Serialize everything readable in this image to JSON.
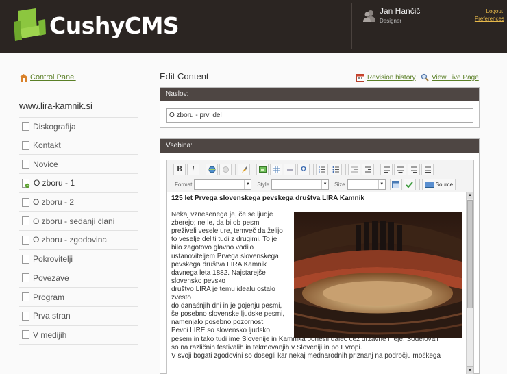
{
  "header": {
    "logo_text": "CushyCMS",
    "user_name": "Jan Hančič",
    "user_role": "Designer",
    "logout": "Logout",
    "preferences": "Preferences"
  },
  "sidebar": {
    "control_panel": "Control Panel",
    "site_name": "www.lira-kamnik.si",
    "pages": [
      {
        "label": "Diskografija"
      },
      {
        "label": "Kontakt"
      },
      {
        "label": "Novice"
      },
      {
        "label": "O zboru - 1"
      },
      {
        "label": "O zboru - 2"
      },
      {
        "label": "O zboru - sedanji člani"
      },
      {
        "label": "O zboru - zgodovina"
      },
      {
        "label": "Pokrovitelji"
      },
      {
        "label": "Povezave"
      },
      {
        "label": "Program"
      },
      {
        "label": "Prva stran"
      },
      {
        "label": "V medijih"
      }
    ]
  },
  "main": {
    "title": "Edit Content",
    "revision_history": "Revision history",
    "view_live_page": "View Live Page",
    "naslov_label": "Naslov:",
    "naslov_value": "O zboru - prvi del",
    "vsebina_label": "Vsebina:"
  },
  "toolbar": {
    "bold": "B",
    "italic": "I",
    "special_char": "Ω",
    "format_label": "Format",
    "style_label": "Style",
    "size_label": "Size",
    "source_label": "Source"
  },
  "document": {
    "heading": "125 let Prvega slovenskega pevskega društva LIRA Kamnik",
    "lines": [
      "Nekaj vznesenega je, če se ljudje",
      "zberejo; ne le, da bi ob pesmi",
      "preživeli vesele ure, temveč da želijo",
      "to veselje deliti tudi z drugimi. To je",
      "bilo zagotovo glavno vodilo",
      "ustanoviteljem Prvega slovenskega",
      "pevskega društva LIRA Kamnik",
      "davnega leta 1882. Najstarejše",
      "slovensko pevsko",
      "društvo LIRA je temu idealu ostalo",
      "zvesto",
      "do današnjih dni in je gojenju pesmi,",
      "še posebno slovenske ljudske pesmi,",
      "namenjalo posebno pozornost.",
      "Pevci LIRE so slovensko ljudsko",
      "pesem in tako tudi ime Slovenije in Kamnika ponesli daleč čez državne meje. Sodelovali",
      "so na različnih festivalih in tekmovanjih v Sloveniji in po Evropi.",
      "V svoji bogati zgodovini so dosegli kar nekaj mednarodnih priznanj na področju moškega"
    ]
  },
  "colors": {
    "header_bg": "#2b2522",
    "panel_header_bg": "#4e4643",
    "link_green": "#5a7f26",
    "logo_green": "#8cc63f",
    "header_link": "#e6b84a"
  }
}
